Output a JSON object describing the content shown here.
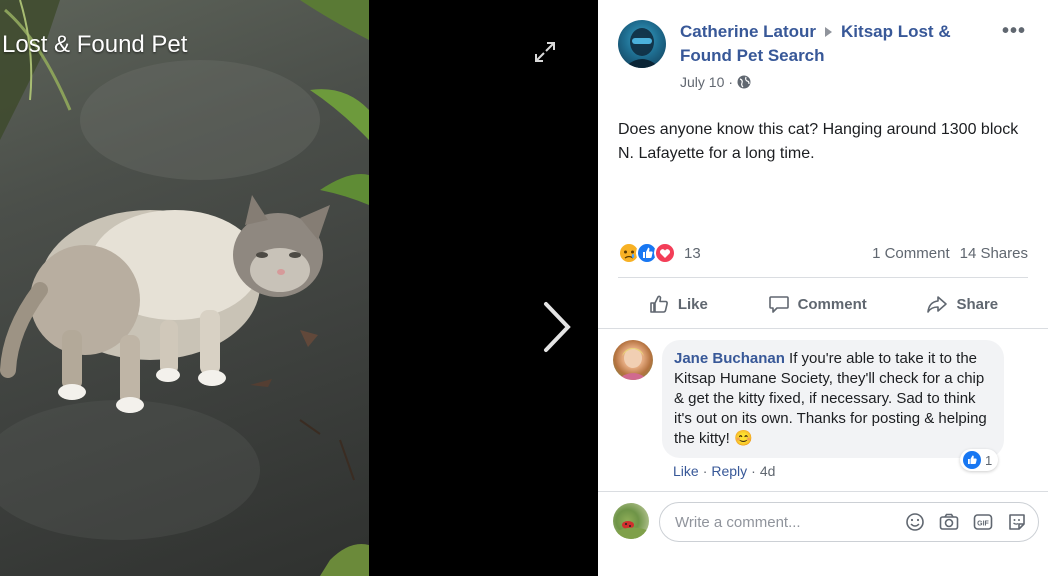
{
  "viewer": {
    "album_title": "Lost & Found Pet"
  },
  "post": {
    "author": "Catherine Latour",
    "group": "Kitsap Lost & Found Pet Search",
    "date": "July 10",
    "privacy_icon": "globe-icon",
    "text": "Does anyone know this cat? Hanging around 1300 block N. Lafayette for a long time.",
    "reaction_count": "13",
    "comments_count": "1 Comment",
    "shares_count": "14 Shares",
    "reaction_types": [
      "sad",
      "like",
      "love"
    ]
  },
  "actions": {
    "like": "Like",
    "comment": "Comment",
    "share": "Share"
  },
  "comment": {
    "author": "Jane Buchanan",
    "text": "If you're able to take it to the Kitsap Humane Society, they'll check for a chip & get the kitty fixed, if necessary. Sad to think it's out on its own. Thanks for posting & helping the kitty! 😊",
    "like_count": "1",
    "like_label": "Like",
    "reply_label": "Reply",
    "time": "4d",
    "separator": "·"
  },
  "composer": {
    "placeholder": "Write a comment..."
  },
  "colors": {
    "link": "#385898",
    "secondary_text": "#606770",
    "like_blue": "#1877f2",
    "love_red": "#f33e58",
    "sad_yellow": "#f7b125"
  }
}
